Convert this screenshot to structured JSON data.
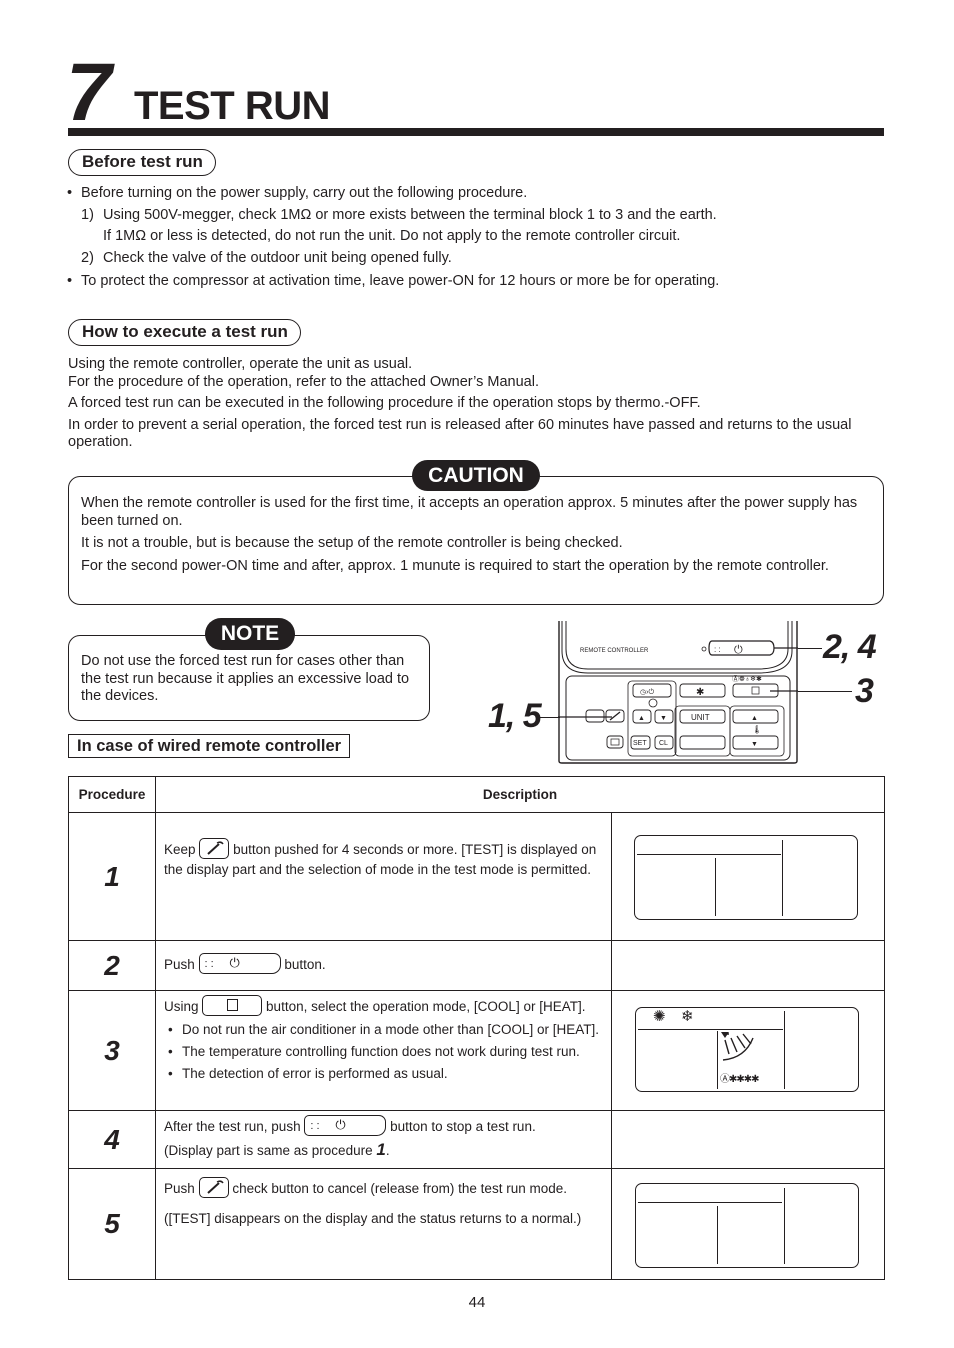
{
  "header": {
    "chapter_number": "7",
    "title": "TEST RUN"
  },
  "before_test_run": {
    "heading": "Before test run",
    "bullets": [
      "Before turning on the power supply, carry out the following procedure.",
      "To protect the compressor at activation time, leave power-ON for 12 hours or more be for operating."
    ],
    "steps": [
      {
        "num": "1)",
        "text": "Using 500V-megger, check 1MΩ or more exists between the terminal block 1 to 3 and the earth.",
        "cont": "If 1MΩ or less is detected, do not run the unit.  Do not apply to the remote controller circuit."
      },
      {
        "num": "2)",
        "text": "Check the valve of the outdoor unit being opened fully."
      }
    ]
  },
  "how_to": {
    "heading": "How to execute a test run",
    "paragraphs": [
      "Using the remote controller, operate the unit as usual.",
      "For the procedure of the operation, refer to the attached Owner’s Manual.",
      "A forced test run can be executed in the following procedure if the operation stops by thermo.-OFF.",
      "In order to prevent a serial operation, the forced test run is released after 60 minutes have passed and returns to the usual operation."
    ]
  },
  "caution": {
    "label": "CAUTION",
    "paragraphs": [
      "When the remote controller is used for the first time, it accepts an operation approx. 5 minutes after the power supply has been turned on.",
      "It is not a trouble, but is because the setup of the remote controller is being checked.",
      "For the second power-ON time and after, approx. 1 munute is required to start the operation by the remote controller."
    ]
  },
  "note": {
    "label": "NOTE",
    "text": "Do not use the forced test run for cases other than the test run because it applies an excessive load to the devices."
  },
  "wired_heading": "In case of wired remote controller",
  "remote": {
    "label": "REMOTE CONTROLLER",
    "unit_button": "UNIT",
    "set_button": "SET",
    "cl_button": "CL",
    "callout_left": "1, 5",
    "callout_top": "2, 4",
    "callout_mid": "3"
  },
  "table": {
    "col_procedure": "Procedure",
    "col_description": "Description",
    "rows": [
      {
        "num": "1",
        "pre": "Keep",
        "post": "button pushed for 4 seconds or more.  [TEST] is displayed on the display part and the selection of mode in the test mode is permitted."
      },
      {
        "num": "2",
        "pre": "Push",
        "post": "button."
      },
      {
        "num": "3",
        "pre": "Using",
        "post": "button, select the operation mode, [COOL] or [HEAT].",
        "bullets": [
          "Do not run the air conditioner in a mode other than [COOL] or [HEAT].",
          "The temperature controlling function does not work during test run.",
          "The detection of error is performed as usual."
        ]
      },
      {
        "num": "4",
        "pre": "After the test run, push",
        "post": "button to stop a test run.",
        "line2": "(Display part is same as procedure",
        "line2_ref": "1",
        "line2_end": "."
      },
      {
        "num": "5",
        "pre": "Push",
        "post": "check button to cancel (release from) the test run mode.",
        "line2": "([TEST] disappears on the display and the status returns to a normal.)"
      }
    ]
  },
  "page_number": "44"
}
